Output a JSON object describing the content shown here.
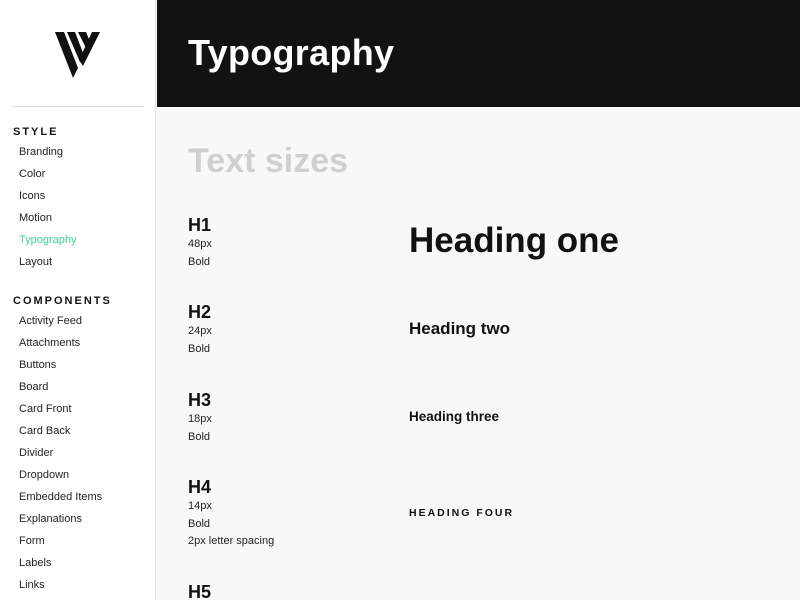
{
  "sidebar": {
    "logo": "brand-logo",
    "sections": [
      {
        "heading": "STYLE",
        "items": [
          {
            "label": "Branding"
          },
          {
            "label": "Color"
          },
          {
            "label": "Icons"
          },
          {
            "label": "Motion"
          },
          {
            "label": "Typography",
            "active": true
          },
          {
            "label": "Layout"
          }
        ]
      },
      {
        "heading": "COMPONENTS",
        "items": [
          {
            "label": "Activity Feed"
          },
          {
            "label": "Attachments"
          },
          {
            "label": "Buttons"
          },
          {
            "label": "Board"
          },
          {
            "label": "Card Front"
          },
          {
            "label": "Card Back"
          },
          {
            "label": "Divider"
          },
          {
            "label": "Dropdown"
          },
          {
            "label": "Embedded Items"
          },
          {
            "label": "Explanations"
          },
          {
            "label": "Form"
          },
          {
            "label": "Labels"
          },
          {
            "label": "Links"
          }
        ]
      }
    ]
  },
  "header": {
    "title": "Typography"
  },
  "main": {
    "section_title": "Text sizes",
    "specs": [
      {
        "label": "H1",
        "lines": [
          "48px",
          "Bold"
        ],
        "sample": "Heading one"
      },
      {
        "label": "H2",
        "lines": [
          "24px",
          "Bold"
        ],
        "sample": "Heading two"
      },
      {
        "label": "H3",
        "lines": [
          "18px",
          "Bold"
        ],
        "sample": "Heading three"
      },
      {
        "label": "H4",
        "lines": [
          "14px",
          "Bold",
          "2px letter spacing"
        ],
        "sample": "Heading four"
      },
      {
        "label": "H5",
        "lines": [],
        "sample": ""
      }
    ]
  },
  "colors": {
    "accent": "#3fd18f",
    "header_bg": "#121212",
    "section_title": "#d0d0d0"
  }
}
